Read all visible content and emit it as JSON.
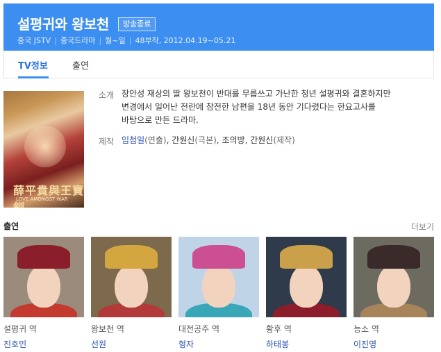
{
  "header": {
    "title": "설평귀와 왕보천",
    "badge": "방송종료",
    "meta": [
      "중국 JSTV",
      "중국드라마",
      "월~일",
      "48부작, 2012.04.19~05.21"
    ]
  },
  "tabs": [
    "TV정보",
    "출연"
  ],
  "poster": {
    "title_text": "薛平貴與王寶釧",
    "subtitle_text": "LOVE AMONGST WAR"
  },
  "info": {
    "summary_label": "소개",
    "summary_lines": [
      "장안성 재상의 딸 왕보천이 반대를 무릅쓰고 가난한 청년 설평귀와 결혼하지만",
      "변경에서 일어난 전란에 참전한 남편을 18년 동안 기다렸다는 한요고사를",
      "바탕으로 만든 드라마."
    ],
    "production_label": "제작",
    "production": {
      "name1": "임첨일",
      "role1": "(연출)",
      "sep1": ", ",
      "name2": "간원신",
      "role2": "(극본)",
      "sep2": ", ",
      "name3": "조의방",
      "sep3": ", ",
      "name4": "간원신",
      "role4": "(제작)"
    }
  },
  "cast_section": {
    "heading": "출연",
    "more": "더보기",
    "members": [
      {
        "role": "설평귀 역",
        "actor": "진호민",
        "colors": {
          "bg": "#9a8b7c",
          "crown": "#8a1e2a",
          "body": "#c33b2e"
        }
      },
      {
        "role": "왕보천 역",
        "actor": "선원",
        "colors": {
          "bg": "#7d6a4c",
          "crown": "#d4a640",
          "body": "#b23a3a"
        }
      },
      {
        "role": "대전공주 역",
        "actor": "형자",
        "colors": {
          "bg": "#bfd4e6",
          "crown": "#cc4f92",
          "body": "#3aa7b8"
        }
      },
      {
        "role": "황후 역",
        "actor": "하태봉",
        "colors": {
          "bg": "#2f3a4a",
          "crown": "#caa14a",
          "body": "#8b1e2a"
        }
      },
      {
        "role": "능소 역",
        "actor": "이진영",
        "colors": {
          "bg": "#6d6a60",
          "crown": "#3a2a2a",
          "body": "#a8845a"
        }
      }
    ]
  }
}
